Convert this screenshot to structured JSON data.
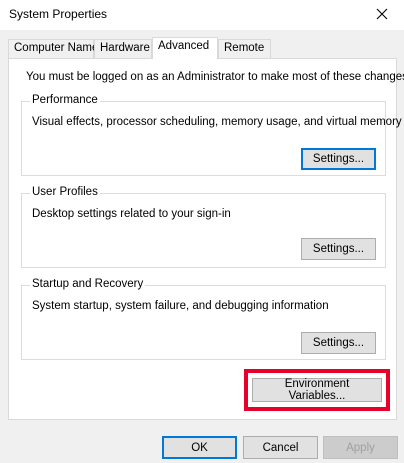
{
  "window": {
    "title": "System Properties"
  },
  "tabs": [
    {
      "label": "Computer Name"
    },
    {
      "label": "Hardware"
    },
    {
      "label": "Advanced"
    },
    {
      "label": "Remote"
    }
  ],
  "active_tab": "Advanced",
  "advanced": {
    "admin_note": "You must be logged on as an Administrator to make most of these changes.",
    "performance": {
      "legend": "Performance",
      "description": "Visual effects, processor scheduling, memory usage, and virtual memory",
      "button": "Settings..."
    },
    "user_profiles": {
      "legend": "User Profiles",
      "description": "Desktop settings related to your sign-in",
      "button": "Settings..."
    },
    "startup_recovery": {
      "legend": "Startup and Recovery",
      "description": "System startup, system failure, and debugging information",
      "button": "Settings..."
    },
    "env_vars_button": "Environment Variables..."
  },
  "footer": {
    "ok": "OK",
    "cancel": "Cancel",
    "apply": "Apply"
  },
  "colors": {
    "highlight": "#e8002d",
    "focus": "#0078d7"
  },
  "icons": {
    "close": "close-icon"
  }
}
